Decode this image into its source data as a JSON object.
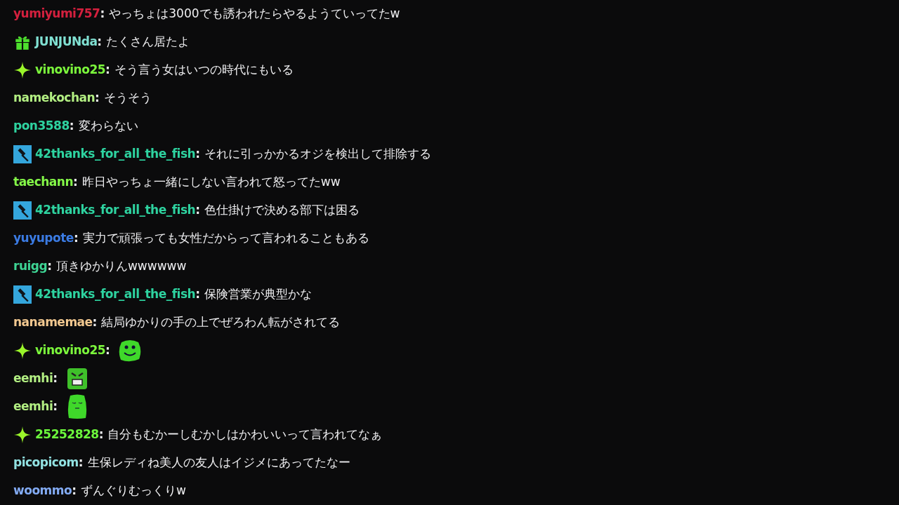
{
  "messages": [
    {
      "user": "yumiyumi757",
      "color": "#d4203e",
      "separator": ":",
      "text": "やっちょは3000でも誘われたらやるようていってたw"
    },
    {
      "user": "JUNJUNda",
      "color": "#80e0d2",
      "badge": {
        "kind": "gift"
      },
      "separator": ":",
      "text": "たくさん居たよ"
    },
    {
      "user": "vinovino25",
      "color": "#7cf83c",
      "badge": {
        "kind": "sparkle"
      },
      "separator": ":",
      "text": "そう言う女はいつの時代にもいる"
    },
    {
      "user": "namekochan",
      "color": "#b2ee82",
      "separator": ":",
      "text": "そうそう"
    },
    {
      "user": "pon3588",
      "color": "#2ed3a0",
      "separator": ":",
      "text": "変わらない"
    },
    {
      "user": "42thanks_for_all_the_fish",
      "color": "#2ed3a0",
      "badge": {
        "kind": "moderator"
      },
      "separator": ":",
      "text": "それに引っかかるオジを検出して排除する"
    },
    {
      "user": "taechann",
      "color": "#84f848",
      "separator": ":",
      "text": "昨日やっちょ一緒にしない言われて怒ってたww"
    },
    {
      "user": "42thanks_for_all_the_fish",
      "color": "#2ed3a0",
      "badge": {
        "kind": "moderator"
      },
      "separator": ":",
      "text": "色仕掛けで決める部下は困る"
    },
    {
      "user": "yuyupote",
      "color": "#3b7be3",
      "separator": ":",
      "text": "実力で頑張っても女性だからって言われることもある"
    },
    {
      "user": "ruigg",
      "color": "#3ed494",
      "separator": ":",
      "text": "頂きゆかりんwwwwww"
    },
    {
      "user": "42thanks_for_all_the_fish",
      "color": "#2ed3a0",
      "badge": {
        "kind": "moderator"
      },
      "separator": ":",
      "text": "保険営業が典型かな"
    },
    {
      "user": "nanamemae",
      "color": "#f2c890",
      "separator": ":",
      "text": "結局ゆかりの手の上でぜろわん転がされてる"
    },
    {
      "user": "vinovino25",
      "color": "#7cf83c",
      "badge": {
        "kind": "sparkle"
      },
      "separator": ":",
      "emote": {
        "kind": "smile"
      }
    },
    {
      "user": "eemhi",
      "color": "#b2ee82",
      "separator": ":",
      "emote": {
        "kind": "angry"
      }
    },
    {
      "user": "eemhi",
      "color": "#b2ee82",
      "separator": ":",
      "emote": {
        "kind": "sleepy"
      }
    },
    {
      "user": "25252828",
      "color": "#6cf83c",
      "badge": {
        "kind": "sparkle"
      },
      "separator": ":",
      "text": "自分もむかーしむかしはかわいいって言われてなぁ"
    },
    {
      "user": "picopicom",
      "color": "#92e2e2",
      "separator": ":",
      "text": "生保レディね美人の友人はイジメにあってたなー"
    },
    {
      "user": "woommo",
      "color": "#82aaf2",
      "separator": ":",
      "text": "ずんぐりむっくりw"
    }
  ]
}
